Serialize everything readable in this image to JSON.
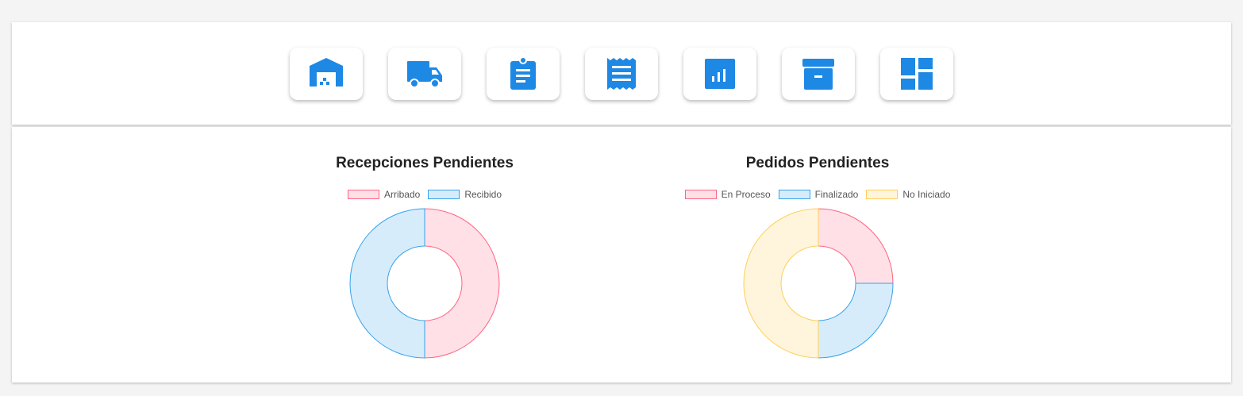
{
  "toolbar": {
    "buttons": [
      {
        "name": "warehouse-button",
        "icon": "warehouse-icon"
      },
      {
        "name": "shipping-button",
        "icon": "truck-icon"
      },
      {
        "name": "assignment-button",
        "icon": "clipboard-icon"
      },
      {
        "name": "receipt-button",
        "icon": "receipt-icon"
      },
      {
        "name": "reports-button",
        "icon": "bar-chart-icon"
      },
      {
        "name": "archive-button",
        "icon": "archive-icon"
      },
      {
        "name": "dashboard-button",
        "icon": "dashboard-icon"
      }
    ],
    "icon_color": "#1e88e5"
  },
  "chart_data": [
    {
      "type": "doughnut",
      "title": "Recepciones Pendientes",
      "categories": [
        "Arribado",
        "Recibido"
      ],
      "values": [
        1,
        1
      ],
      "colors": {
        "fill": [
          "#ffe0e6",
          "#d7ecfb"
        ],
        "stroke": [
          "#ff6384",
          "#36a2eb"
        ]
      },
      "legend_placement": "top"
    },
    {
      "type": "doughnut",
      "title": "Pedidos Pendientes",
      "categories": [
        "En Proceso",
        "Finalizado",
        "No Iniciado"
      ],
      "values": [
        1,
        1,
        2
      ],
      "colors": {
        "fill": [
          "#ffe0e6",
          "#d7ecfb",
          "#fff5dd"
        ],
        "stroke": [
          "#ff6384",
          "#36a2eb",
          "#ffce56"
        ]
      },
      "legend_placement": "top"
    }
  ]
}
